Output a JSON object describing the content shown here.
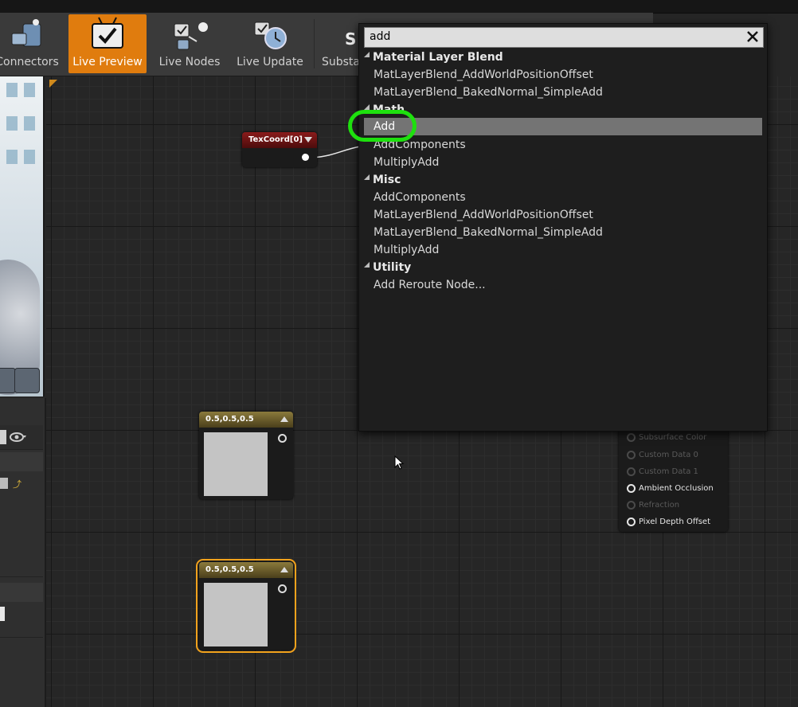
{
  "toolbar": {
    "buttons": [
      {
        "label": "Connectors",
        "icon": "connectors-icon"
      },
      {
        "label": "Live Preview",
        "icon": "live-preview-icon",
        "active": true
      },
      {
        "label": "Live Nodes",
        "icon": "live-nodes-icon"
      },
      {
        "label": "Live Update",
        "icon": "live-update-icon"
      },
      {
        "label": "Substa",
        "icon": "substance-icon"
      }
    ]
  },
  "graph": {
    "texcoord_node": {
      "title": "TexCoord[0]"
    },
    "constant_nodes": [
      {
        "title": "0.5,0.5,0.5"
      },
      {
        "title": "0.5,0.5,0.5"
      }
    ],
    "result_pins": [
      {
        "label": "Subsurface Color",
        "enabled": false
      },
      {
        "label": "Custom Data 0",
        "enabled": false
      },
      {
        "label": "Custom Data 1",
        "enabled": false
      },
      {
        "label": "Ambient Occlusion",
        "enabled": true
      },
      {
        "label": "Refraction",
        "enabled": false
      },
      {
        "label": "Pixel Depth Offset",
        "enabled": true
      }
    ]
  },
  "context_menu": {
    "search_value": "add",
    "categories": [
      {
        "name": "Material Layer Blend",
        "items": [
          "MatLayerBlend_AddWorldPositionOffset",
          "MatLayerBlend_BakedNormal_SimpleAdd"
        ]
      },
      {
        "name": "Math",
        "items": [
          "Add",
          "AddComponents",
          "MultiplyAdd"
        ]
      },
      {
        "name": "Misc",
        "items": [
          "AddComponents",
          "MatLayerBlend_AddWorldPositionOffset",
          "MatLayerBlend_BakedNormal_SimpleAdd",
          "MultiplyAdd"
        ]
      },
      {
        "name": "Utility",
        "items": [
          "Add Reroute Node..."
        ]
      }
    ],
    "selected_item": "Add"
  },
  "colors": {
    "accent_orange": "#e07c0e",
    "highlight_green": "#1ee00e",
    "selected_row": "#747474"
  }
}
